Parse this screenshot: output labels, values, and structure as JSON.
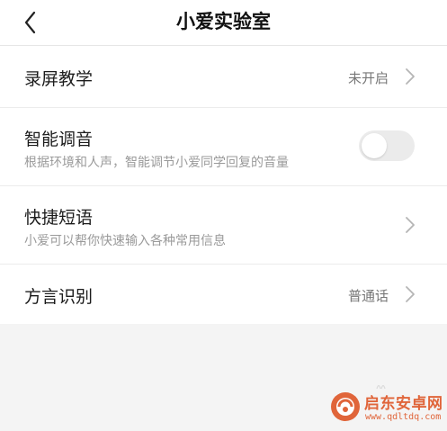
{
  "header": {
    "title": "小爱实验室",
    "back_icon": "chevron-left-icon"
  },
  "settings": [
    {
      "title": "录屏教学",
      "value": "未开启",
      "control": "chevron"
    },
    {
      "title": "智能调音",
      "subtitle": "根据环境和人声，智能调节小爱同学回复的音量",
      "control": "toggle",
      "toggle_on": false
    },
    {
      "title": "快捷短语",
      "subtitle": "小爱可以帮你快速输入各种常用信息",
      "control": "chevron"
    },
    {
      "title": "方言识别",
      "value": "普通话",
      "control": "chevron"
    }
  ],
  "colors": {
    "background": "#f4f4f4",
    "card": "#ffffff",
    "toggle_off": "#ebebeb",
    "watermark": "#e0653a"
  },
  "watermark": {
    "name": "启东安卓网",
    "url": "www.qdltdq.com"
  }
}
